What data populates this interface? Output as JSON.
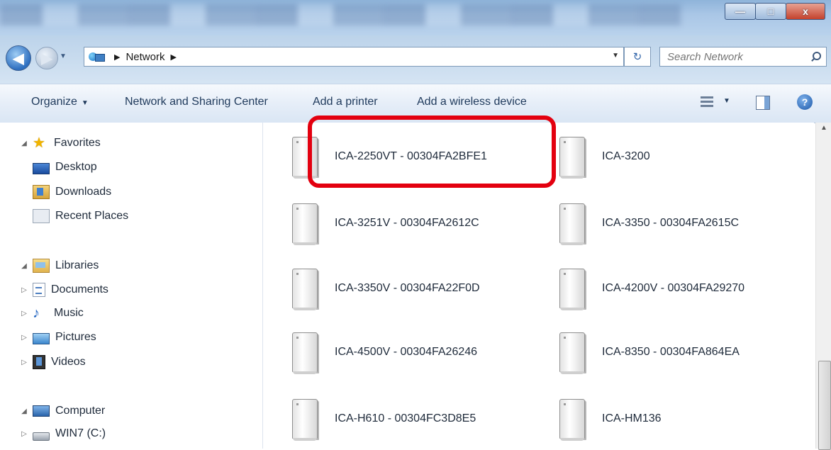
{
  "window": {
    "controls": {
      "minimize": "—",
      "maximize": "□",
      "close": "x"
    }
  },
  "address_bar": {
    "breadcrumb": [
      "Network"
    ],
    "search_placeholder": "Search Network"
  },
  "command_bar": {
    "organize": "Organize",
    "network_sharing": "Network and Sharing Center",
    "add_printer": "Add a printer",
    "add_wireless": "Add a wireless device"
  },
  "nav": {
    "favorites": {
      "label": "Favorites",
      "items": [
        "Desktop",
        "Downloads",
        "Recent Places"
      ]
    },
    "libraries": {
      "label": "Libraries",
      "items": [
        "Documents",
        "Music",
        "Pictures",
        "Videos"
      ]
    },
    "computer": {
      "label": "Computer",
      "items": [
        "WIN7 (C:)"
      ]
    }
  },
  "devices": [
    "ICA-2250VT - 00304FA2BFE1",
    "ICA-3200",
    "ICA-3251V - 00304FA2612C",
    "ICA-3350 - 00304FA2615C",
    "ICA-3350V - 00304FA22F0D",
    "ICA-4200V - 00304FA29270",
    "ICA-4500V - 00304FA26246",
    "ICA-8350 - 00304FA864EA",
    "ICA-H610 - 00304FC3D8E5",
    "ICA-HM136"
  ],
  "highlighted_device": "ICA-2250VT - 00304FA2BFE1",
  "accent_colors": {
    "highlight": "#e3000f",
    "toolbar_text": "#1e395b"
  }
}
